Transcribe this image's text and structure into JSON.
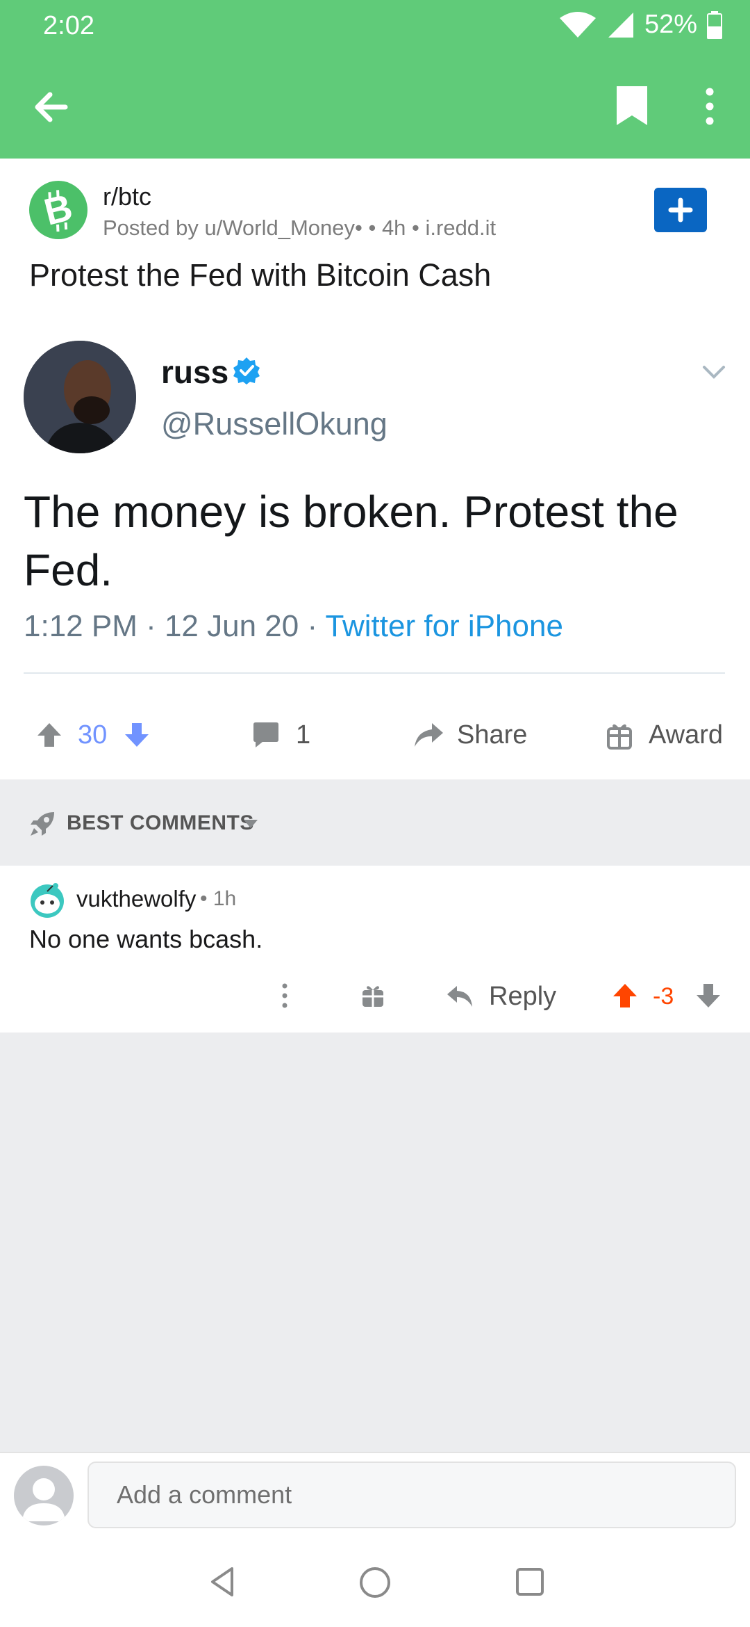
{
  "status_bar": {
    "time": "2:02",
    "battery": "52%"
  },
  "toolbar": {
    "back_icon": "arrow-left-icon",
    "bookmark_icon": "bookmark-icon",
    "more_icon": "more-vert-icon"
  },
  "post": {
    "subreddit": "r/btc",
    "meta": "Posted by u/World_Money• • 4h • i.redd.it",
    "title": "Protest the Fed with Bitcoin Cash",
    "join_icon": "plus-icon"
  },
  "tweet": {
    "name": "russ",
    "handle": "@RussellOkung",
    "text": "The money is broken. Protest the Fed.",
    "time": "1:12 PM · 12 Jun 20 · ",
    "source": "Twitter for iPhone"
  },
  "actions": {
    "votes": "30",
    "comments": "1",
    "share": "Share",
    "award": "Award"
  },
  "sort": {
    "label": "BEST COMMENTS"
  },
  "comment": {
    "user": "vukthewolfy",
    "time": "• 1h",
    "text": "No one wants bcash.",
    "reply": "Reply",
    "score": "-3"
  },
  "reply_bar": {
    "placeholder": "Add a comment"
  },
  "colors": {
    "header": "#60CB79",
    "upvote_active": "#FF4500",
    "vote_count": "#7193FF",
    "join": "#0A66C2",
    "link": "#1B95E0"
  }
}
